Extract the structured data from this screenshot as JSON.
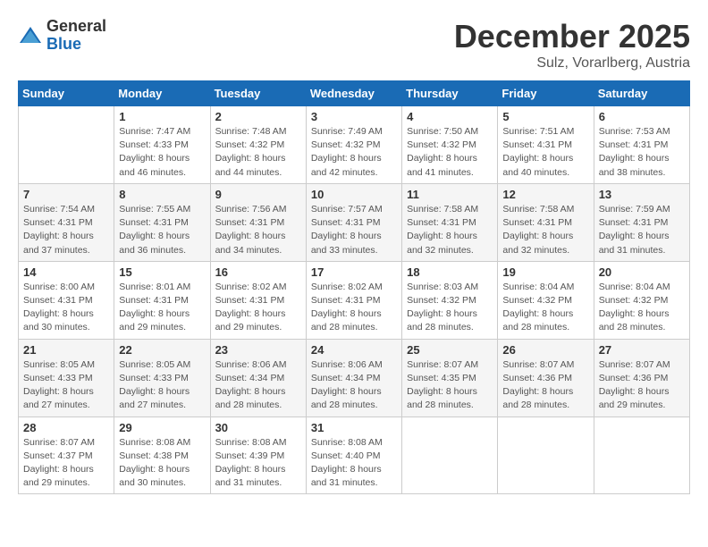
{
  "logo": {
    "general": "General",
    "blue": "Blue"
  },
  "title": "December 2025",
  "location": "Sulz, Vorarlberg, Austria",
  "weekdays": [
    "Sunday",
    "Monday",
    "Tuesday",
    "Wednesday",
    "Thursday",
    "Friday",
    "Saturday"
  ],
  "weeks": [
    [
      {
        "day": "",
        "info": ""
      },
      {
        "day": "1",
        "info": "Sunrise: 7:47 AM\nSunset: 4:33 PM\nDaylight: 8 hours\nand 46 minutes."
      },
      {
        "day": "2",
        "info": "Sunrise: 7:48 AM\nSunset: 4:32 PM\nDaylight: 8 hours\nand 44 minutes."
      },
      {
        "day": "3",
        "info": "Sunrise: 7:49 AM\nSunset: 4:32 PM\nDaylight: 8 hours\nand 42 minutes."
      },
      {
        "day": "4",
        "info": "Sunrise: 7:50 AM\nSunset: 4:32 PM\nDaylight: 8 hours\nand 41 minutes."
      },
      {
        "day": "5",
        "info": "Sunrise: 7:51 AM\nSunset: 4:31 PM\nDaylight: 8 hours\nand 40 minutes."
      },
      {
        "day": "6",
        "info": "Sunrise: 7:53 AM\nSunset: 4:31 PM\nDaylight: 8 hours\nand 38 minutes."
      }
    ],
    [
      {
        "day": "7",
        "info": "Sunrise: 7:54 AM\nSunset: 4:31 PM\nDaylight: 8 hours\nand 37 minutes."
      },
      {
        "day": "8",
        "info": "Sunrise: 7:55 AM\nSunset: 4:31 PM\nDaylight: 8 hours\nand 36 minutes."
      },
      {
        "day": "9",
        "info": "Sunrise: 7:56 AM\nSunset: 4:31 PM\nDaylight: 8 hours\nand 34 minutes."
      },
      {
        "day": "10",
        "info": "Sunrise: 7:57 AM\nSunset: 4:31 PM\nDaylight: 8 hours\nand 33 minutes."
      },
      {
        "day": "11",
        "info": "Sunrise: 7:58 AM\nSunset: 4:31 PM\nDaylight: 8 hours\nand 32 minutes."
      },
      {
        "day": "12",
        "info": "Sunrise: 7:58 AM\nSunset: 4:31 PM\nDaylight: 8 hours\nand 32 minutes."
      },
      {
        "day": "13",
        "info": "Sunrise: 7:59 AM\nSunset: 4:31 PM\nDaylight: 8 hours\nand 31 minutes."
      }
    ],
    [
      {
        "day": "14",
        "info": "Sunrise: 8:00 AM\nSunset: 4:31 PM\nDaylight: 8 hours\nand 30 minutes."
      },
      {
        "day": "15",
        "info": "Sunrise: 8:01 AM\nSunset: 4:31 PM\nDaylight: 8 hours\nand 29 minutes."
      },
      {
        "day": "16",
        "info": "Sunrise: 8:02 AM\nSunset: 4:31 PM\nDaylight: 8 hours\nand 29 minutes."
      },
      {
        "day": "17",
        "info": "Sunrise: 8:02 AM\nSunset: 4:31 PM\nDaylight: 8 hours\nand 28 minutes."
      },
      {
        "day": "18",
        "info": "Sunrise: 8:03 AM\nSunset: 4:32 PM\nDaylight: 8 hours\nand 28 minutes."
      },
      {
        "day": "19",
        "info": "Sunrise: 8:04 AM\nSunset: 4:32 PM\nDaylight: 8 hours\nand 28 minutes."
      },
      {
        "day": "20",
        "info": "Sunrise: 8:04 AM\nSunset: 4:32 PM\nDaylight: 8 hours\nand 28 minutes."
      }
    ],
    [
      {
        "day": "21",
        "info": "Sunrise: 8:05 AM\nSunset: 4:33 PM\nDaylight: 8 hours\nand 27 minutes."
      },
      {
        "day": "22",
        "info": "Sunrise: 8:05 AM\nSunset: 4:33 PM\nDaylight: 8 hours\nand 27 minutes."
      },
      {
        "day": "23",
        "info": "Sunrise: 8:06 AM\nSunset: 4:34 PM\nDaylight: 8 hours\nand 28 minutes."
      },
      {
        "day": "24",
        "info": "Sunrise: 8:06 AM\nSunset: 4:34 PM\nDaylight: 8 hours\nand 28 minutes."
      },
      {
        "day": "25",
        "info": "Sunrise: 8:07 AM\nSunset: 4:35 PM\nDaylight: 8 hours\nand 28 minutes."
      },
      {
        "day": "26",
        "info": "Sunrise: 8:07 AM\nSunset: 4:36 PM\nDaylight: 8 hours\nand 28 minutes."
      },
      {
        "day": "27",
        "info": "Sunrise: 8:07 AM\nSunset: 4:36 PM\nDaylight: 8 hours\nand 29 minutes."
      }
    ],
    [
      {
        "day": "28",
        "info": "Sunrise: 8:07 AM\nSunset: 4:37 PM\nDaylight: 8 hours\nand 29 minutes."
      },
      {
        "day": "29",
        "info": "Sunrise: 8:08 AM\nSunset: 4:38 PM\nDaylight: 8 hours\nand 30 minutes."
      },
      {
        "day": "30",
        "info": "Sunrise: 8:08 AM\nSunset: 4:39 PM\nDaylight: 8 hours\nand 31 minutes."
      },
      {
        "day": "31",
        "info": "Sunrise: 8:08 AM\nSunset: 4:40 PM\nDaylight: 8 hours\nand 31 minutes."
      },
      {
        "day": "",
        "info": ""
      },
      {
        "day": "",
        "info": ""
      },
      {
        "day": "",
        "info": ""
      }
    ]
  ]
}
